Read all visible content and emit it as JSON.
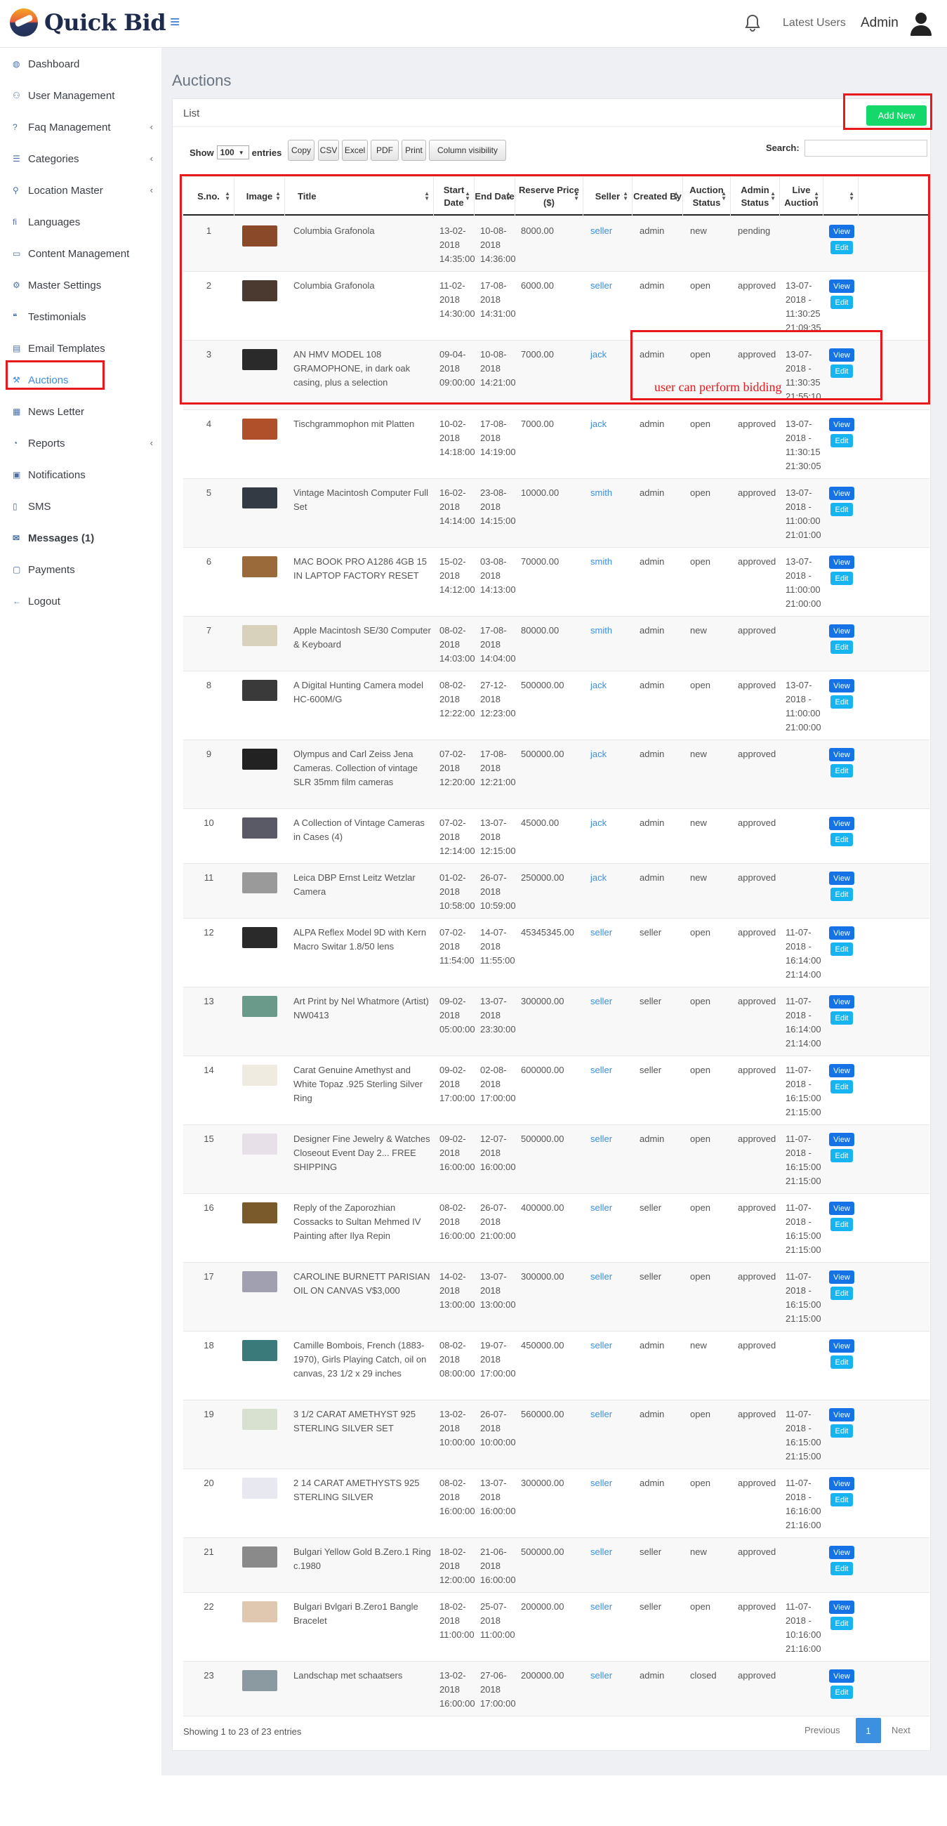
{
  "app": {
    "name": "Quick Bid"
  },
  "header": {
    "latest_users": "Latest Users",
    "admin": "Admin"
  },
  "sidebar": {
    "items": [
      {
        "label": "Dashboard",
        "icon": "dashboard-icon",
        "chevron": false
      },
      {
        "label": "User Management",
        "icon": "users-icon",
        "chevron": false
      },
      {
        "label": "Faq Management",
        "icon": "question-icon",
        "chevron": true
      },
      {
        "label": "Categories",
        "icon": "list-icon",
        "chevron": true
      },
      {
        "label": "Location Master",
        "icon": "map-marker-icon",
        "chevron": true
      },
      {
        "label": "Languages",
        "icon": "language-icon",
        "chevron": false
      },
      {
        "label": "Content Management",
        "icon": "file-icon",
        "chevron": false
      },
      {
        "label": "Master Settings",
        "icon": "cogs-icon",
        "chevron": false
      },
      {
        "label": "Testimonials",
        "icon": "quote-icon",
        "chevron": false
      },
      {
        "label": "Email Templates",
        "icon": "book-icon",
        "chevron": false
      },
      {
        "label": "Auctions",
        "icon": "gavel-icon",
        "chevron": false,
        "active": true
      },
      {
        "label": "News Letter",
        "icon": "newspaper-icon",
        "chevron": false
      },
      {
        "label": "Reports",
        "icon": "pie-chart-icon",
        "chevron": true
      },
      {
        "label": "Notifications",
        "icon": "briefcase-icon",
        "chevron": false
      },
      {
        "label": "SMS",
        "icon": "mobile-icon",
        "chevron": false
      },
      {
        "label": "Messages (1)",
        "icon": "envelope-icon",
        "chevron": false,
        "bold": true
      },
      {
        "label": "Payments",
        "icon": "money-icon",
        "chevron": false
      },
      {
        "label": "Logout",
        "icon": "logout-arrow-icon",
        "chevron": false
      }
    ]
  },
  "page": {
    "title": "Auctions",
    "card_title": "List",
    "add_new": "Add New"
  },
  "toolbar": {
    "show": "Show",
    "length": "100",
    "entries": "entries",
    "buttons": [
      "Copy",
      "CSV",
      "Excel",
      "PDF",
      "Print",
      "Column visibility"
    ],
    "search_label": "Search:"
  },
  "table": {
    "columns": [
      "S.no.",
      "Image",
      "Title",
      "Start Date",
      "End Date",
      "Reserve Price ($)",
      "Seller",
      "Created By",
      "Auction Status",
      "Admin Status",
      "Live Auction",
      ""
    ],
    "view_label": "View",
    "edit_label": "Edit",
    "rows": [
      {
        "sno": "1",
        "title": "Columbia Grafonola",
        "start": "13-02-2018 14:35:00",
        "end": "10-08-2018 14:36:00",
        "price": "8000.00",
        "seller": "seller",
        "created": "admin",
        "astatus": "new",
        "admin": "pending",
        "live": "",
        "color": "#8a4a2a"
      },
      {
        "sno": "2",
        "title": "Columbia Grafonola",
        "start": "11-02-2018 14:30:00",
        "end": "17-08-2018 14:31:00",
        "price": "6000.00",
        "seller": "seller",
        "created": "admin",
        "astatus": "open",
        "admin": "approved",
        "live": "13-07-2018 - 11:30:25 21:09:35",
        "color": "#4a3a30"
      },
      {
        "sno": "3",
        "title": "AN HMV MODEL 108 GRAMOPHONE, in dark oak casing, plus a selection",
        "start": "09-04-2018 09:00:00",
        "end": "10-08-2018 14:21:00",
        "price": "7000.00",
        "seller": "jack",
        "created": "admin",
        "astatus": "open",
        "admin": "approved",
        "live": "13-07-2018 - 11:30:35 21:55:10",
        "color": "#2a2a2a"
      },
      {
        "sno": "4",
        "title": "Tischgrammophon mit Platten",
        "start": "10-02-2018 14:18:00",
        "end": "17-08-2018 14:19:00",
        "price": "7000.00",
        "seller": "jack",
        "created": "admin",
        "astatus": "open",
        "admin": "approved",
        "live": "13-07-2018 - 11:30:15 21:30:05",
        "color": "#b0502a"
      },
      {
        "sno": "5",
        "title": "Vintage Macintosh Computer Full Set",
        "start": "16-02-2018 14:14:00",
        "end": "23-08-2018 14:15:00",
        "price": "10000.00",
        "seller": "smith",
        "created": "admin",
        "astatus": "open",
        "admin": "approved",
        "live": "13-07-2018 - 11:00:00 21:01:00",
        "color": "#333a44"
      },
      {
        "sno": "6",
        "title": "MAC BOOK PRO A1286 4GB 15 IN LAPTOP FACTORY RESET",
        "start": "15-02-2018 14:12:00",
        "end": "03-08-2018 14:13:00",
        "price": "70000.00",
        "seller": "smith",
        "created": "admin",
        "astatus": "open",
        "admin": "approved",
        "live": "13-07-2018 - 11:00:00 21:00:00",
        "color": "#9a6a3a"
      },
      {
        "sno": "7",
        "title": "Apple Macintosh SE/30 Computer & Keyboard",
        "start": "08-02-2018 14:03:00",
        "end": "17-08-2018 14:04:00",
        "price": "80000.00",
        "seller": "smith",
        "created": "admin",
        "astatus": "new",
        "admin": "approved",
        "live": "",
        "color": "#d8d2bc"
      },
      {
        "sno": "8",
        "title": "A Digital Hunting Camera model HC-600M/G",
        "start": "08-02-2018 12:22:00",
        "end": "27-12-2018 12:23:00",
        "price": "500000.00",
        "seller": "jack",
        "created": "admin",
        "astatus": "open",
        "admin": "approved",
        "live": "13-07-2018 - 11:00:00 21:00:00",
        "color": "#3a3a3a"
      },
      {
        "sno": "9",
        "title": "Olympus and Carl Zeiss Jena Cameras. Collection of vintage SLR 35mm film cameras",
        "start": "07-02-2018 12:20:00",
        "end": "17-08-2018 12:21:00",
        "price": "500000.00",
        "seller": "jack",
        "created": "admin",
        "astatus": "new",
        "admin": "approved",
        "live": "",
        "color": "#222222"
      },
      {
        "sno": "10",
        "title": "A Collection of Vintage Cameras in Cases (4)",
        "start": "07-02-2018 12:14:00",
        "end": "13-07-2018 12:15:00",
        "price": "45000.00",
        "seller": "jack",
        "created": "admin",
        "astatus": "new",
        "admin": "approved",
        "live": "",
        "color": "#5a5a66"
      },
      {
        "sno": "11",
        "title": "Leica DBP Ernst Leitz Wetzlar Camera",
        "start": "01-02-2018 10:58:00",
        "end": "26-07-2018 10:59:00",
        "price": "250000.00",
        "seller": "jack",
        "created": "admin",
        "astatus": "new",
        "admin": "approved",
        "live": "",
        "color": "#9a9a9a"
      },
      {
        "sno": "12",
        "title": "ALPA Reflex Model 9D with Kern Macro Switar 1.8/50 lens",
        "start": "07-02-2018 11:54:00",
        "end": "14-07-2018 11:55:00",
        "price": "45345345.00",
        "seller": "seller",
        "created": "seller",
        "astatus": "open",
        "admin": "approved",
        "live": "11-07-2018 - 16:14:00 21:14:00",
        "color": "#2a2a2a"
      },
      {
        "sno": "13",
        "title": "Art Print by Nel Whatmore (Artist) NW0413",
        "start": "09-02-2018 05:00:00",
        "end": "13-07-2018 23:30:00",
        "price": "300000.00",
        "seller": "seller",
        "created": "seller",
        "astatus": "open",
        "admin": "approved",
        "live": "11-07-2018 - 16:14:00 21:14:00",
        "color": "#6a9a8a"
      },
      {
        "sno": "14",
        "title": "Carat Genuine Amethyst and White Topaz .925 Sterling Silver Ring",
        "start": "09-02-2018 17:00:00",
        "end": "02-08-2018 17:00:00",
        "price": "600000.00",
        "seller": "seller",
        "created": "seller",
        "astatus": "open",
        "admin": "approved",
        "live": "11-07-2018 - 16:15:00 21:15:00",
        "color": "#f0ebe0"
      },
      {
        "sno": "15",
        "title": "Designer Fine Jewelry & Watches Closeout Event Day 2... FREE SHIPPING",
        "start": "09-02-2018 16:00:00",
        "end": "12-07-2018 16:00:00",
        "price": "500000.00",
        "seller": "seller",
        "created": "admin",
        "astatus": "open",
        "admin": "approved",
        "live": "11-07-2018 - 16:15:00 21:15:00",
        "color": "#e8e0e8"
      },
      {
        "sno": "16",
        "title": "Reply of the Zaporozhian Cossacks to Sultan Mehmed IV Painting after Ilya Repin",
        "start": "08-02-2018 16:00:00",
        "end": "26-07-2018 21:00:00",
        "price": "400000.00",
        "seller": "seller",
        "created": "seller",
        "astatus": "open",
        "admin": "approved",
        "live": "11-07-2018 - 16:15:00 21:15:00",
        "color": "#7a5a2a"
      },
      {
        "sno": "17",
        "title": "CAROLINE BURNETT PARISIAN OIL ON CANVAS V$3,000",
        "start": "14-02-2018 13:00:00",
        "end": "13-07-2018 13:00:00",
        "price": "300000.00",
        "seller": "seller",
        "created": "seller",
        "astatus": "open",
        "admin": "approved",
        "live": "11-07-2018 - 16:15:00 21:15:00",
        "color": "#a0a0b0"
      },
      {
        "sno": "18",
        "title": "Camille Bombois, French (1883-1970), Girls Playing Catch, oil on canvas, 23 1/2 x 29 inches",
        "start": "08-02-2018 08:00:00",
        "end": "19-07-2018 17:00:00",
        "price": "450000.00",
        "seller": "seller",
        "created": "admin",
        "astatus": "new",
        "admin": "approved",
        "live": "",
        "color": "#3a7a7a"
      },
      {
        "sno": "19",
        "title": "3 1/2 CARAT AMETHYST 925 STERLING SILVER SET",
        "start": "13-02-2018 10:00:00",
        "end": "26-07-2018 10:00:00",
        "price": "560000.00",
        "seller": "seller",
        "created": "admin",
        "astatus": "open",
        "admin": "approved",
        "live": "11-07-2018 - 16:15:00 21:15:00",
        "color": "#d8e0d0"
      },
      {
        "sno": "20",
        "title": "2 14 CARAT AMETHYSTS 925 STERLING SILVER",
        "start": "08-02-2018 16:00:00",
        "end": "13-07-2018 16:00:00",
        "price": "300000.00",
        "seller": "seller",
        "created": "admin",
        "astatus": "open",
        "admin": "approved",
        "live": "11-07-2018 - 16:16:00 21:16:00",
        "color": "#e8e8f0"
      },
      {
        "sno": "21",
        "title": "Bulgari Yellow Gold B.Zero.1 Ring c.1980",
        "start": "18-02-2018 12:00:00",
        "end": "21-06-2018 16:00:00",
        "price": "500000.00",
        "seller": "seller",
        "created": "seller",
        "astatus": "new",
        "admin": "approved",
        "live": "",
        "color": "#8a8a8a"
      },
      {
        "sno": "22",
        "title": "Bulgari Bvlgari B.Zero1 Bangle Bracelet",
        "start": "18-02-2018 11:00:00",
        "end": "25-07-2018 11:00:00",
        "price": "200000.00",
        "seller": "seller",
        "created": "seller",
        "astatus": "open",
        "admin": "approved",
        "live": "11-07-2018 - 10:16:00 21:16:00",
        "color": "#e0c8b0"
      },
      {
        "sno": "23",
        "title": "Landschap met schaatsers",
        "start": "13-02-2018 16:00:00",
        "end": "27-06-2018 17:00:00",
        "price": "200000.00",
        "seller": "seller",
        "created": "admin",
        "astatus": "closed",
        "admin": "approved",
        "live": "",
        "color": "#8a9aa0"
      }
    ]
  },
  "footer": {
    "info": "Showing 1 to 23 of 23 entries",
    "previous": "Previous",
    "page": "1",
    "next": "Next"
  },
  "annotation": {
    "note": "user can perform bidding",
    "color": "#e8191c"
  }
}
